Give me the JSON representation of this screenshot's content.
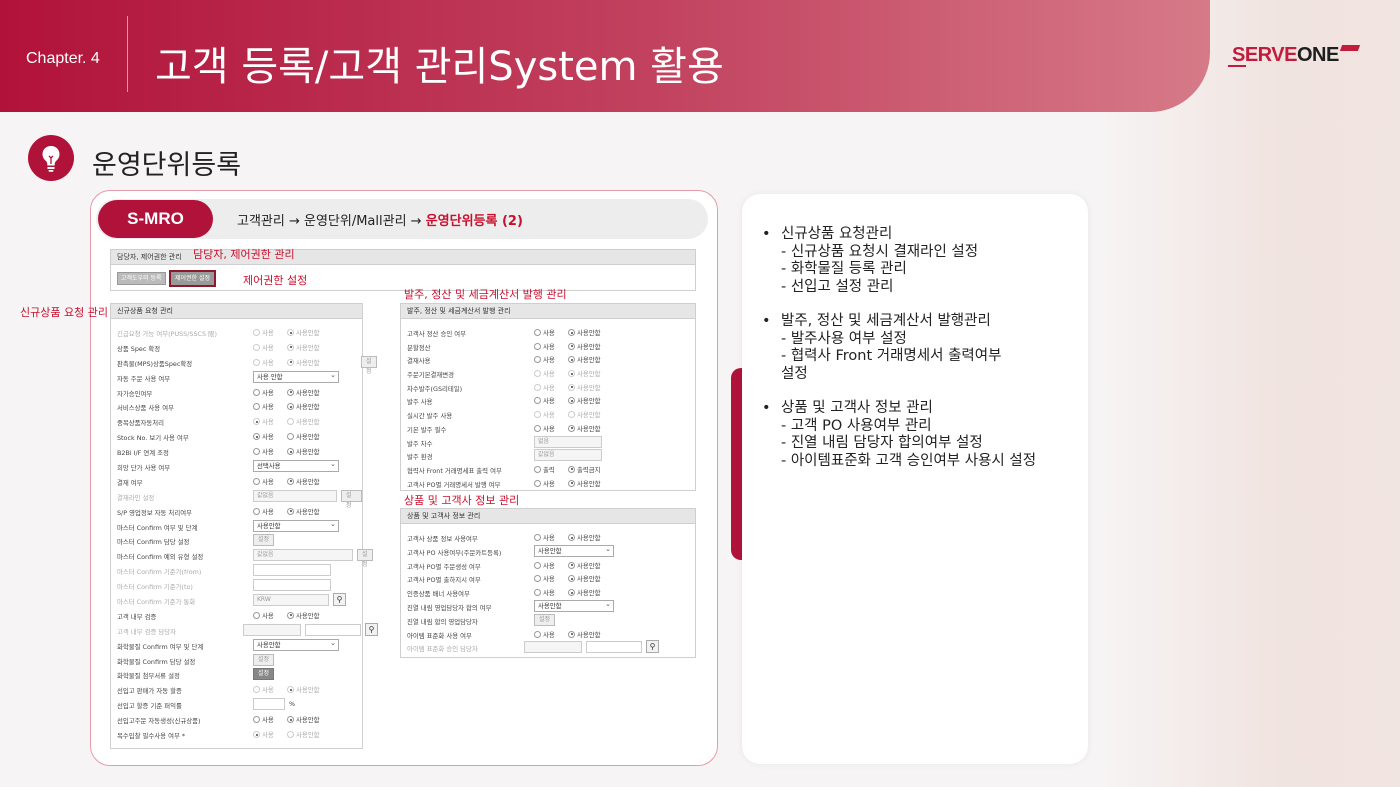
{
  "header": {
    "chapter": "Chapter. 4",
    "title": "고객 등록/고객 관리System 활용",
    "logo_s": "S",
    "logo_rest": "ERVE",
    "logo_one": "ONE"
  },
  "section": {
    "title": "운영단위등록"
  },
  "breadcrumb": {
    "badge": "S-MRO",
    "path": "고객관리 → 운영단위/Mall관리 → ",
    "current": "운영단위등록 (2)"
  },
  "top_panel": {
    "title": "담당자, 제어권한 관리",
    "tab1": "고객도우미 등록",
    "tab2": "제어권한 설정"
  },
  "annotations": {
    "top": "담당자, 제어권한 관리",
    "control": "제어권한 설정",
    "left": "신규상품 요청 관리",
    "order": "발주, 정산 및 세금계산서 발행 관리",
    "product": "상품 및 고객사 정보 관리"
  },
  "common": {
    "use": "사용",
    "nouse": "사용안함",
    "setting": "설정",
    "none": "값없음"
  },
  "left_panel": {
    "title": "신규상품 요청 관리",
    "rows": [
      {
        "label": "긴급요청 가능 여부(PUSS/SSCS 限)",
        "dim": true,
        "radio": "2"
      },
      {
        "label": "상품 Spec 확정",
        "radio": "2",
        "dimr": true
      },
      {
        "label": "판촉물(MPS)상품Spec확정",
        "radio": "2",
        "dimr": true,
        "btn": true
      },
      {
        "label": "자동 주문 사용 여부",
        "select": "사용 안함"
      },
      {
        "label": "자가승인여부",
        "radio": "2"
      },
      {
        "label": "서비스상품 사용 여부",
        "radio": "2"
      },
      {
        "label": "중복상품자동처리",
        "radio": "1",
        "dimr": true
      },
      {
        "label": "Stock No. 보기 사용 여부",
        "radio": "1"
      },
      {
        "label": "B2Bi I/F 연계 조정",
        "radio": "2"
      },
      {
        "label": "희망 단가 사용 여부",
        "select": "선택사용"
      },
      {
        "label": "결재 여부",
        "radio": "2"
      },
      {
        "label": "결재라인 설정",
        "dim": true,
        "inp": true,
        "btn": true
      },
      {
        "label": "S/P 영업정보 자동 처리여부",
        "radio": "2"
      },
      {
        "label": "마스터 Confirm 여부 및 단계",
        "select": "사용안함"
      },
      {
        "label": "마스터 Confirm 담당 설정",
        "btnonly": true
      },
      {
        "label": "마스터 Confirm 예외 유형 설정",
        "inpw": true,
        "btnfar": true
      },
      {
        "label": "마스터 Confirm 기준가(from)",
        "dim": true,
        "blank": true
      },
      {
        "label": "마스터 Confirm 기준가(to)",
        "dim": true,
        "blank": true
      },
      {
        "label": "마스터 Confirm 기준가 통화",
        "dim": true,
        "krw": "KRW"
      },
      {
        "label": "고객 내부 검증",
        "radio": "2"
      },
      {
        "label": "고객 내부 검증 담당자",
        "dim": true,
        "twoinp": true
      },
      {
        "label": "화학물질 Confirm 여부 및 단계",
        "select": "사용안함"
      },
      {
        "label": "화학물질 Confirm 담당 설정",
        "btnonly": true
      },
      {
        "label": "화학물질 첨부서류 설정",
        "btndark": true
      },
      {
        "label": "선입고 판매가 자동 할증",
        "radio": "2",
        "dimr": true
      },
      {
        "label": "선입고 할증 기준 퍼익률",
        "pct": "%"
      },
      {
        "label": "선입고주문 자동생성(신규상품)",
        "radio": "2"
      },
      {
        "label": "복수입찰 필수사용 여부 *",
        "radio": "1",
        "dimr": true
      }
    ]
  },
  "order_panel": {
    "title": "발주, 정산 및 세금계산서 발행 관리",
    "rows": [
      {
        "label": "고객사 정산 승인 여부",
        "radio": "2"
      },
      {
        "label": "분할정산",
        "radio": "2"
      },
      {
        "label": "결재사용",
        "radio": "2"
      },
      {
        "label": "주문기본결재변경",
        "radio": "2",
        "dimr": true
      },
      {
        "label": "차수발주(GS리테일)",
        "radio": "2",
        "dimr": true
      },
      {
        "label": "발주 사용",
        "radio": "2"
      },
      {
        "label": "실시간 발주 사용",
        "radio": "0",
        "dimr": true
      },
      {
        "label": "기본 발주 필수",
        "radio": "2"
      },
      {
        "label": "발주 차수",
        "inp2": "없음"
      },
      {
        "label": "발주 환경",
        "inp2": "값없음"
      },
      {
        "label": "협력사 Front 거래명세표 출력 여부",
        "radio": "2",
        "alt": [
          "출력",
          "출력금지"
        ]
      },
      {
        "label": "고객사 PO별 거래명세서 발행 여부",
        "radio": "2"
      }
    ]
  },
  "product_panel": {
    "title": "상품 및 고객사 정보 관리",
    "rows": [
      {
        "label": "고객사 상품 정보 사용여부",
        "radio": "2"
      },
      {
        "label": "고객사 PO 사용여부(주문카트등록)",
        "select": "사용안함"
      },
      {
        "label": "고객사 PO별 주문생성 여부",
        "radio": "2"
      },
      {
        "label": "고객사 PO별 출하지시 여부",
        "radio": "2"
      },
      {
        "label": "인증상품 배너 사용여부",
        "radio": "2"
      },
      {
        "label": "진열 내림 영업담당자 합의 여부",
        "select": "사용안함"
      },
      {
        "label": "진열 내림 합의 영업담당자",
        "btnonly": true
      },
      {
        "label": "아이템 표준화 사용 여부",
        "radio": "2"
      },
      {
        "label": "아이템 표준화 승인 담당자",
        "dim": true,
        "twoinp": true
      }
    ]
  },
  "right_notes": [
    {
      "head": "신규상품 요청관리",
      "subs": [
        "- 신규상품 요청시 결재라인 설정",
        "- 화학물질 등록 관리",
        "- 선입고 설정 관리"
      ]
    },
    {
      "head": "발주, 정산 및 세금계산서 발행관리",
      "subs": [
        "- 발주사용 여부 설정",
        "- 협력사 Front 거래명세서 출력여부",
        "설정"
      ]
    },
    {
      "head": "상품 및 고객사 정보 관리",
      "subs": [
        "- 고객 PO 사용여부 관리",
        "- 진열 내림 담당자 합의여부 설정",
        "- 아이템표준화 고객 승인여부 사용시 설정"
      ]
    }
  ]
}
